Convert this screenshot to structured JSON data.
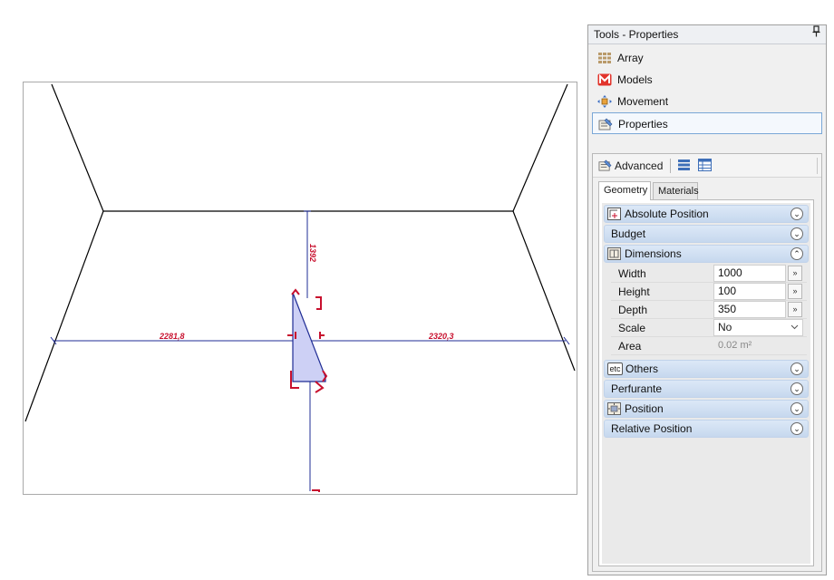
{
  "viewport": {
    "dim_left": "2281,8",
    "dim_right": "2320,3",
    "dim_top": "1392",
    "colors": {
      "lines": "#000000",
      "dimension": "#1f2c94",
      "markers": "#c8102e",
      "shape_fill": "#cdd0f5"
    }
  },
  "panel": {
    "title": "Tools - Properties",
    "pin_glyph": "📌",
    "nav": [
      {
        "label": "Array",
        "icon": "array-icon"
      },
      {
        "label": "Models",
        "icon": "models-icon"
      },
      {
        "label": "Movement",
        "icon": "movement-icon"
      },
      {
        "label": "Properties",
        "icon": "properties-icon",
        "selected": true
      }
    ],
    "advanced_label": "Advanced",
    "tabs": [
      "Geometry",
      "Materials"
    ],
    "sections": {
      "absolute_position": "Absolute Position",
      "budget": "Budget",
      "dimensions": "Dimensions",
      "others": "Others",
      "perfurante": "Perfurante",
      "position": "Position",
      "relative_position": "Relative Position"
    },
    "dimensions": {
      "width_label": "Width",
      "width_value": "1000",
      "height_label": "Height",
      "height_value": "100",
      "depth_label": "Depth",
      "depth_value": "350",
      "scale_label": "Scale",
      "scale_value": "No",
      "area_label": "Area",
      "area_value": "0.02 m²"
    },
    "chevron_down": "⌄",
    "chevron_up": "⌃",
    "more_glyph": "»",
    "etc_label": "etc"
  }
}
